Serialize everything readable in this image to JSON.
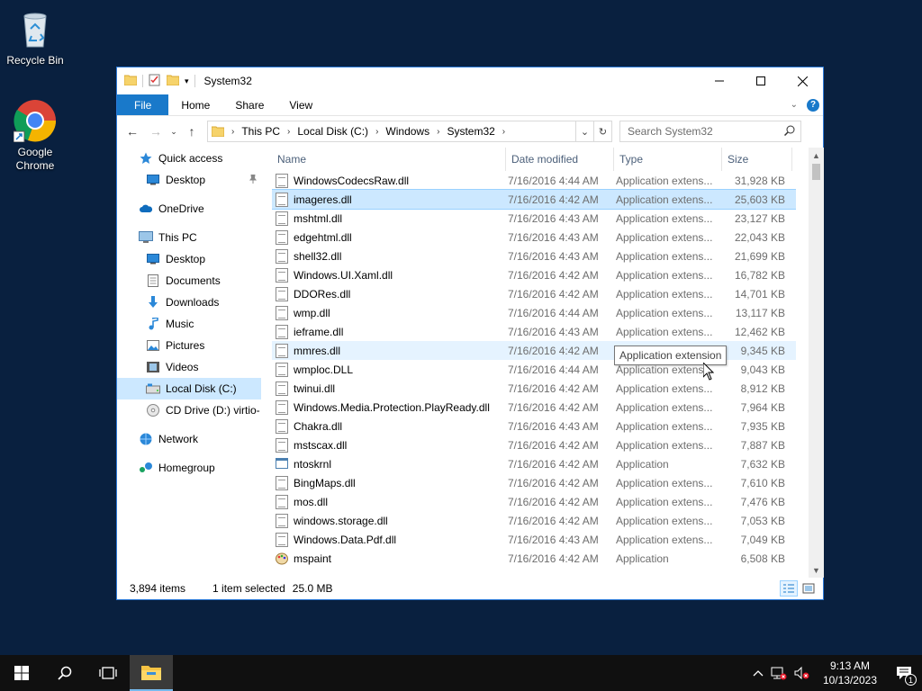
{
  "desktop": {
    "icons": [
      {
        "label": "Recycle Bin"
      },
      {
        "label": "Google Chrome"
      }
    ]
  },
  "window": {
    "title": "System32",
    "ribbon_tabs": [
      "File",
      "Home",
      "Share",
      "View"
    ],
    "breadcrumb": [
      "This PC",
      "Local Disk (C:)",
      "Windows",
      "System32"
    ],
    "search_placeholder": "Search System32"
  },
  "navpane": {
    "items": [
      {
        "label": "Quick access",
        "icon": "star-icon",
        "level": 0
      },
      {
        "label": "Desktop",
        "icon": "desktop-icon",
        "level": 1,
        "pinned": true
      },
      {
        "label": "OneDrive",
        "icon": "cloud-icon",
        "level": 0
      },
      {
        "label": "This PC",
        "icon": "computer-icon",
        "level": 0
      },
      {
        "label": "Desktop",
        "icon": "desktop-icon",
        "level": 1
      },
      {
        "label": "Documents",
        "icon": "documents-icon",
        "level": 1
      },
      {
        "label": "Downloads",
        "icon": "download-icon",
        "level": 1
      },
      {
        "label": "Music",
        "icon": "music-icon",
        "level": 1
      },
      {
        "label": "Pictures",
        "icon": "pictures-icon",
        "level": 1
      },
      {
        "label": "Videos",
        "icon": "videos-icon",
        "level": 1
      },
      {
        "label": "Local Disk (C:)",
        "icon": "drive-icon",
        "level": 1,
        "selected": true
      },
      {
        "label": "CD Drive (D:) virtio-",
        "icon": "cd-drive-icon",
        "level": 1
      },
      {
        "label": "Network",
        "icon": "network-icon",
        "level": 0
      },
      {
        "label": "Homegroup",
        "icon": "homegroup-icon",
        "level": 0
      }
    ]
  },
  "filelist": {
    "columns": {
      "name": "Name",
      "date": "Date modified",
      "type": "Type",
      "size": "Size"
    },
    "rows": [
      {
        "name": "WindowsCodecsRaw.dll",
        "date": "7/16/2016 4:44 AM",
        "type": "Application extens...",
        "size": "31,928 KB"
      },
      {
        "name": "imageres.dll",
        "date": "7/16/2016 4:42 AM",
        "type": "Application extens...",
        "size": "25,603 KB",
        "selected": true
      },
      {
        "name": "mshtml.dll",
        "date": "7/16/2016 4:43 AM",
        "type": "Application extens...",
        "size": "23,127 KB"
      },
      {
        "name": "edgehtml.dll",
        "date": "7/16/2016 4:43 AM",
        "type": "Application extens...",
        "size": "22,043 KB"
      },
      {
        "name": "shell32.dll",
        "date": "7/16/2016 4:43 AM",
        "type": "Application extens...",
        "size": "21,699 KB"
      },
      {
        "name": "Windows.UI.Xaml.dll",
        "date": "7/16/2016 4:42 AM",
        "type": "Application extens...",
        "size": "16,782 KB"
      },
      {
        "name": "DDORes.dll",
        "date": "7/16/2016 4:42 AM",
        "type": "Application extens...",
        "size": "14,701 KB"
      },
      {
        "name": "wmp.dll",
        "date": "7/16/2016 4:44 AM",
        "type": "Application extens...",
        "size": "13,117 KB"
      },
      {
        "name": "ieframe.dll",
        "date": "7/16/2016 4:43 AM",
        "type": "Application extens...",
        "size": "12,462 KB"
      },
      {
        "name": "mmres.dll",
        "date": "7/16/2016 4:42 AM",
        "type": "",
        "size": "9,345 KB",
        "hover": true
      },
      {
        "name": "wmploc.DLL",
        "date": "7/16/2016 4:44 AM",
        "type": "Application extens...",
        "size": "9,043 KB"
      },
      {
        "name": "twinui.dll",
        "date": "7/16/2016 4:42 AM",
        "type": "Application extens...",
        "size": "8,912 KB"
      },
      {
        "name": "Windows.Media.Protection.PlayReady.dll",
        "date": "7/16/2016 4:42 AM",
        "type": "Application extens...",
        "size": "7,964 KB"
      },
      {
        "name": "Chakra.dll",
        "date": "7/16/2016 4:43 AM",
        "type": "Application extens...",
        "size": "7,935 KB"
      },
      {
        "name": "mstscax.dll",
        "date": "7/16/2016 4:42 AM",
        "type": "Application extens...",
        "size": "7,887 KB"
      },
      {
        "name": "ntoskrnl",
        "date": "7/16/2016 4:42 AM",
        "type": "Application",
        "size": "7,632 KB"
      },
      {
        "name": "BingMaps.dll",
        "date": "7/16/2016 4:42 AM",
        "type": "Application extens...",
        "size": "7,610 KB"
      },
      {
        "name": "mos.dll",
        "date": "7/16/2016 4:42 AM",
        "type": "Application extens...",
        "size": "7,476 KB"
      },
      {
        "name": "windows.storage.dll",
        "date": "7/16/2016 4:42 AM",
        "type": "Application extens...",
        "size": "7,053 KB"
      },
      {
        "name": "Windows.Data.Pdf.dll",
        "date": "7/16/2016 4:43 AM",
        "type": "Application extens...",
        "size": "7,049 KB"
      },
      {
        "name": "mspaint",
        "date": "7/16/2016 4:42 AM",
        "type": "Application",
        "size": "6,508 KB"
      }
    ]
  },
  "tooltip": "Application extension",
  "status": {
    "items": "3,894 items",
    "selected": "1 item selected",
    "size": "25.0 MB"
  },
  "taskbar": {
    "time": "9:13 AM",
    "date": "10/13/2023",
    "notifications": "1"
  }
}
